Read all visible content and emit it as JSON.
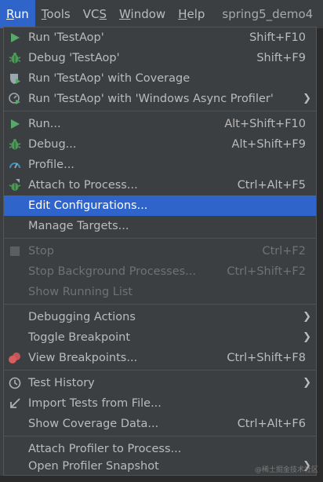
{
  "menubar": {
    "items": [
      "Run",
      "Tools",
      "VCS",
      "Window",
      "Help"
    ],
    "project_title": "spring5_demo4"
  },
  "menu": {
    "run_config": "Run 'TestAop'",
    "run_config_shortcut": "Shift+F10",
    "debug_config": "Debug 'TestAop'",
    "debug_config_shortcut": "Shift+F9",
    "coverage": "Run 'TestAop' with Coverage",
    "async_profiler": "Run 'TestAop' with 'Windows Async Profiler'",
    "run": "Run...",
    "run_shortcut": "Alt+Shift+F10",
    "debug": "Debug...",
    "debug_shortcut": "Alt+Shift+F9",
    "profile": "Profile...",
    "attach": "Attach to Process...",
    "attach_shortcut": "Ctrl+Alt+F5",
    "edit_configs": "Edit Configurations...",
    "manage_targets": "Manage Targets...",
    "stop": "Stop",
    "stop_shortcut": "Ctrl+F2",
    "stop_bg": "Stop Background Processes...",
    "stop_bg_shortcut": "Ctrl+Shift+F2",
    "show_running": "Show Running List",
    "debugging_actions": "Debugging Actions",
    "toggle_breakpoint": "Toggle Breakpoint",
    "view_breakpoints": "View Breakpoints...",
    "view_breakpoints_shortcut": "Ctrl+Shift+F8",
    "test_history": "Test History",
    "import_tests": "Import Tests from File...",
    "show_coverage": "Show Coverage Data...",
    "show_coverage_shortcut": "Ctrl+Alt+F6",
    "attach_profiler": "Attach Profiler to Process...",
    "open_snapshot": "Open Profiler Snapshot"
  },
  "watermark": "@稀土掘金技术社区",
  "colors": {
    "menu_bg": "#3c3f41",
    "selection": "#2f65ca",
    "run_green": "#59a869",
    "debug_green": "#499c54",
    "breakpoint_red": "#db5c5c",
    "profiler_blue": "#3592c4"
  }
}
